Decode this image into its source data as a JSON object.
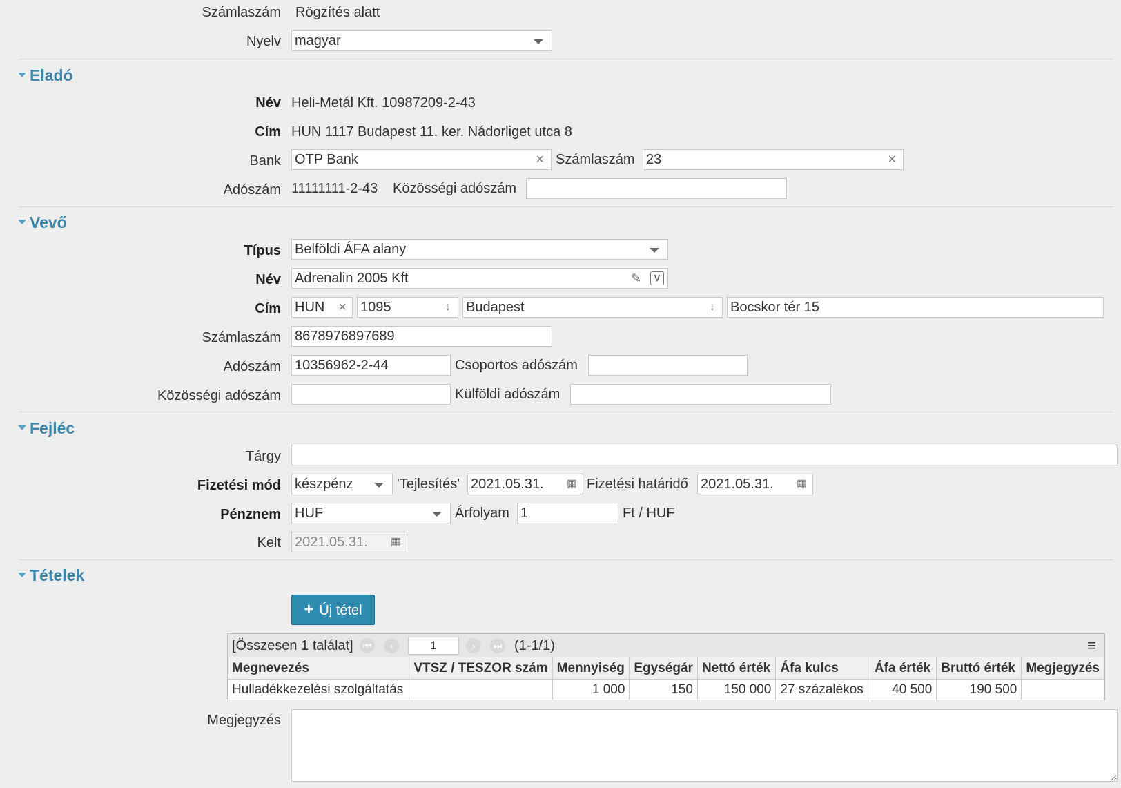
{
  "top": {
    "szamlaszam_label": "Számlaszám",
    "szamlaszam_value": "Rögzítés alatt",
    "nyelv_label": "Nyelv",
    "nyelv_value": "magyar"
  },
  "elado": {
    "title": "Eladó",
    "nev_label": "Név",
    "nev_value": "Heli-Metál Kft. 10987209-2-43",
    "cim_label": "Cím",
    "cim_value": "HUN 1117 Budapest 11. ker. Nádorliget utca 8",
    "bank_label": "Bank",
    "bank_value": "OTP Bank",
    "szamlaszam_label": "Számlaszám",
    "szamlaszam_value": "23",
    "adoszam_label": "Adószám",
    "adoszam_value": "11111111-2-43",
    "kozossegi_label": "Közösségi adószám",
    "kozossegi_value": ""
  },
  "vevo": {
    "title": "Vevő",
    "tipus_label": "Típus",
    "tipus_value": "Belföldi ÁFA alany",
    "nev_label": "Név",
    "nev_value": "Adrenalin 2005 Kft",
    "cim_label": "Cím",
    "country": "HUN",
    "zip": "1095",
    "city": "Budapest",
    "street": "Bocskor tér 15",
    "szamlaszam_label": "Számlaszám",
    "szamlaszam_value": "8678976897689",
    "adoszam_label": "Adószám",
    "adoszam_value": "10356962-2-44",
    "csoportos_label": "Csoportos adószám",
    "csoportos_value": "",
    "kozossegi_label": "Közösségi adószám",
    "kozossegi_value": "",
    "kulfoldi_label": "Külföldi adószám",
    "kulfoldi_value": ""
  },
  "fejlec": {
    "title": "Fejléc",
    "targy_label": "Tárgy",
    "targy_value": "",
    "fizmod_label": "Fizetési mód",
    "fizmod_value": "készpénz",
    "teljesites_label": "'Tejlesítés'",
    "teljesites_value": "2021.05.31.",
    "hatarido_label": "Fizetési határidő",
    "hatarido_value": "2021.05.31.",
    "penznem_label": "Pénznem",
    "penznem_value": "HUF",
    "arfolyam_label": "Árfolyam",
    "arfolyam_value": "1",
    "arfolyam_unit": "Ft / HUF",
    "kelt_label": "Kelt",
    "kelt_value": "2021.05.31."
  },
  "tetelek": {
    "title": "Tételek",
    "new_button": "Új tétel",
    "summary": "[Összesen 1 találat]",
    "page_input": "1",
    "page_info": "(1-1/1)",
    "columns": [
      "Megnevezés",
      "VTSZ / TESZOR szám",
      "Mennyiség",
      "Egységár",
      "Nettó érték",
      "Áfa kulcs",
      "Áfa érték",
      "Bruttó érték",
      "Megjegyzés"
    ],
    "rows": [
      [
        "Hulladékkezelési szolgáltatás",
        "",
        "1 000",
        "150",
        "150 000",
        "27 százalékos",
        "40 500",
        "190 500",
        ""
      ]
    ]
  },
  "megjegyzes": {
    "label": "Megjegyzés",
    "value": ""
  }
}
